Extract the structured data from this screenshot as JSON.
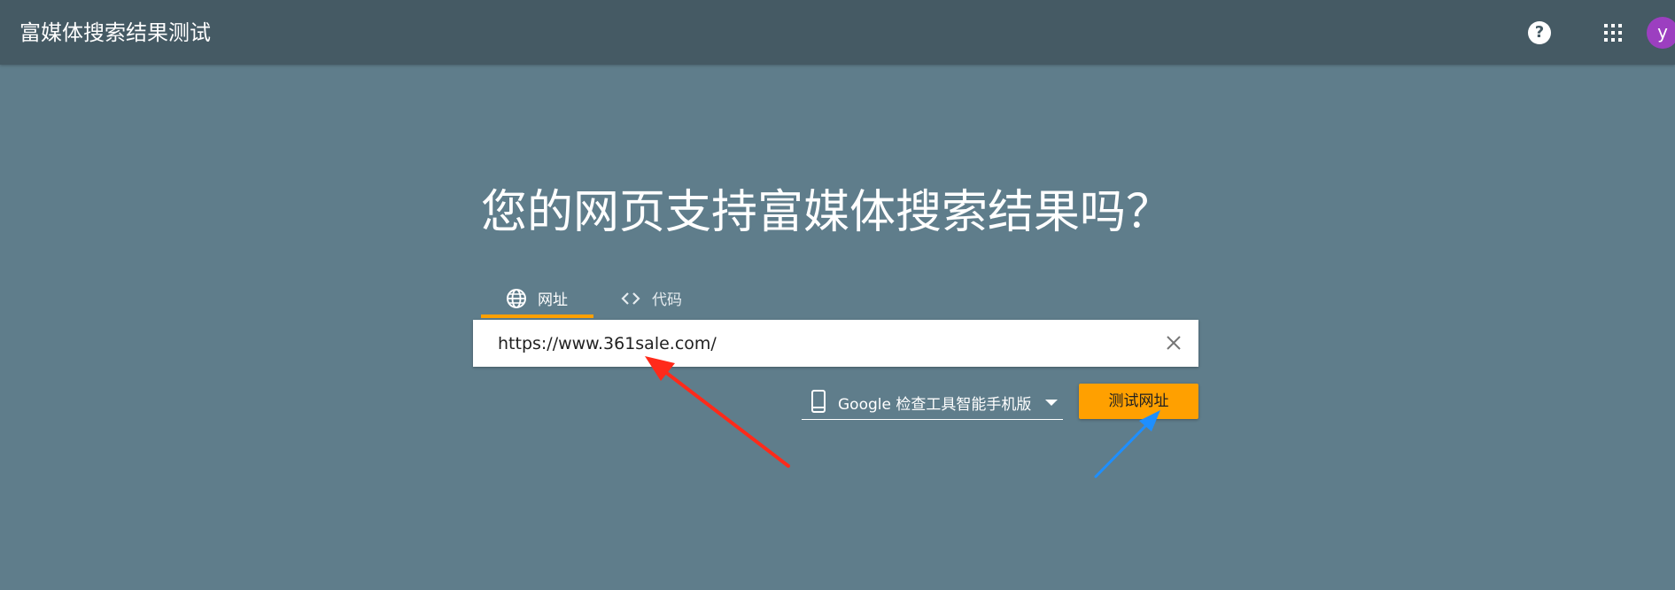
{
  "header": {
    "title": "富媒体搜索结果测试",
    "help_label": "?",
    "avatar_letter": "y"
  },
  "main": {
    "headline": "您的网页支持富媒体搜索结果吗？",
    "tabs": [
      {
        "label": "网址",
        "icon": "globe-icon",
        "selected": true
      },
      {
        "label": "代码",
        "icon": "code-icon",
        "selected": false
      }
    ],
    "url_input": {
      "value": "https://www.361sale.com/"
    },
    "device_select": {
      "selected": "Google 检查工具智能手机版",
      "icon": "smartphone-icon"
    },
    "test_button": "测试网址"
  },
  "colors": {
    "background": "#5f7d8b",
    "appbar": "#455a64",
    "accent": "#ffa000",
    "avatar": "#9c3fc0",
    "annotation_red": "#ff2a1a",
    "annotation_blue": "#1e8fff"
  }
}
